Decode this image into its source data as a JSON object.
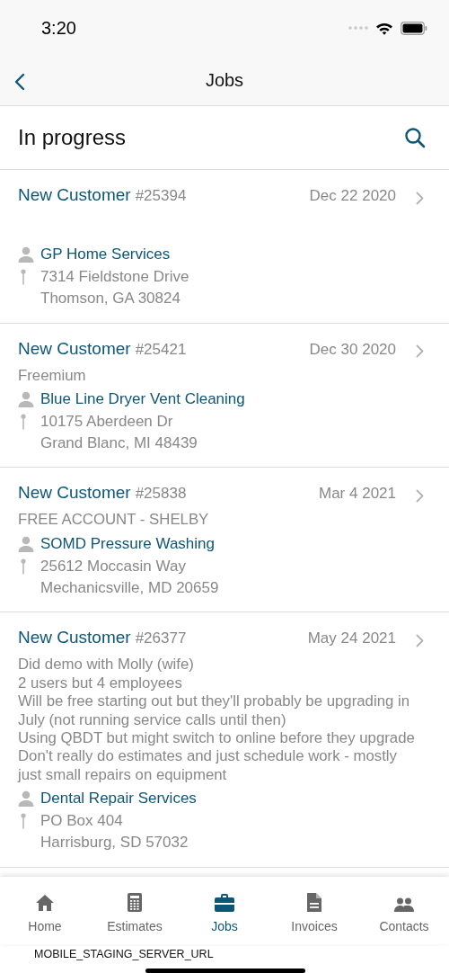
{
  "status_bar": {
    "time": "3:20"
  },
  "nav": {
    "title": "Jobs"
  },
  "header": {
    "title": "In progress"
  },
  "jobs": [
    {
      "name": "New Customer",
      "number": "#25394",
      "date": "Dec 22 2020",
      "customer": "GP Home Services",
      "address": [
        "7314 Fieldstone Drive",
        "Thomson, GA 30824"
      ]
    },
    {
      "name": "New Customer",
      "number": "#25421",
      "date": "Dec 30 2020",
      "notes": [
        "Freemium"
      ],
      "customer": "Blue Line Dryer Vent Cleaning",
      "address": [
        "10175 Aberdeen Dr",
        "Grand Blanc, MI 48439"
      ]
    },
    {
      "name": "New Customer",
      "number": "#25838",
      "date": "Mar 4 2021",
      "notes": [
        "FREE ACCOUNT - SHELBY"
      ],
      "customer": "SOMD Pressure Washing",
      "address": [
        "25612 Moccasin Way",
        "Mechanicsville, MD 20659"
      ]
    },
    {
      "name": "New Customer",
      "number": "#26377",
      "date": "May 24 2021",
      "notes": [
        "Did demo with Molly (wife)",
        "2 users but 4 employees",
        "Will be free starting out but they'll probably be upgrading in July (not running service calls until then)",
        "Using QBDT but might switch to online before they upgrade",
        "Don't really do estimates and just schedule work - mostly just small repairs on equipment"
      ],
      "customer": "Dental Repair Services",
      "address": [
        "PO Box 404",
        "Harrisburg, SD 57032"
      ]
    }
  ],
  "tabs": [
    {
      "label": "Home",
      "selected": false
    },
    {
      "label": "Estimates",
      "selected": false
    },
    {
      "label": "Jobs",
      "selected": true
    },
    {
      "label": "Invoices",
      "selected": false
    },
    {
      "label": "Contacts",
      "selected": false
    }
  ],
  "footer": {
    "text": "MOBILE_STAGING_SERVER_URL"
  }
}
